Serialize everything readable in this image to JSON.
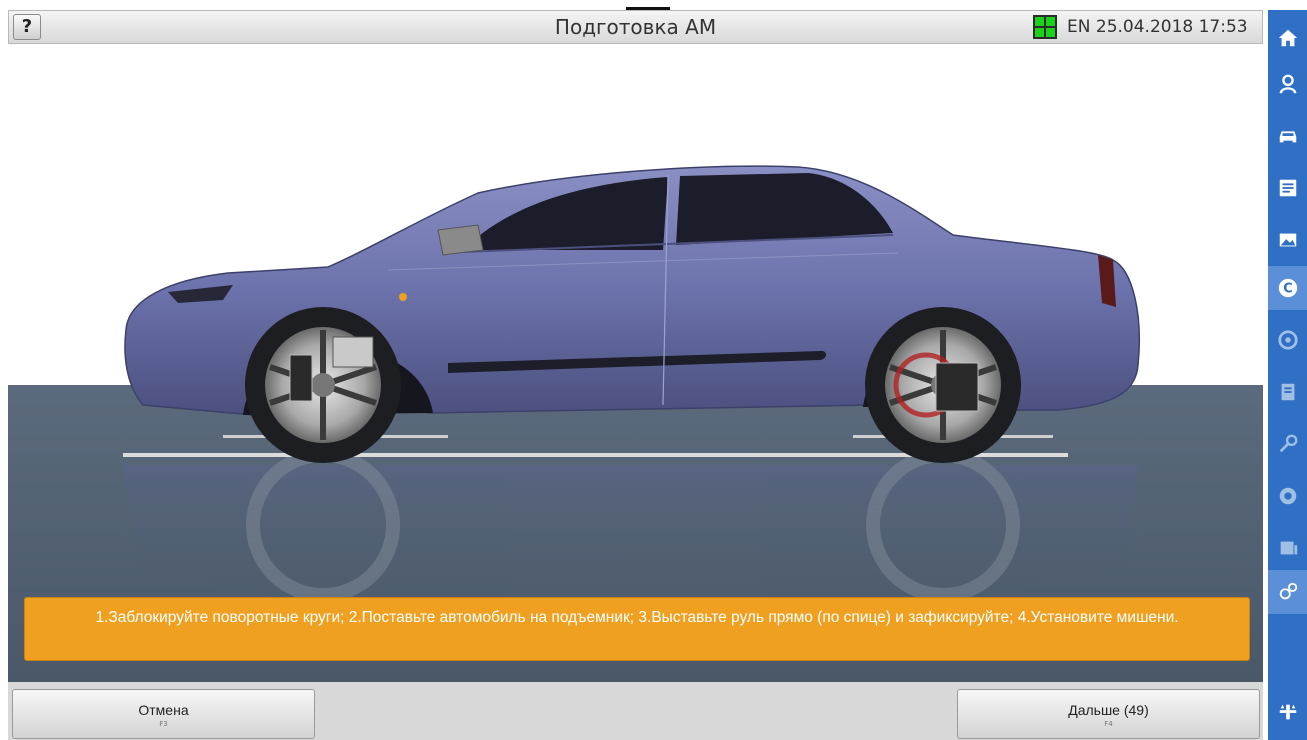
{
  "header": {
    "help_label": "?",
    "title": "Подготовка АМ",
    "language": "EN",
    "datetime": "25.04.2018 17:53",
    "status_color": "#19d219"
  },
  "sidebar": {
    "items": [
      {
        "name": "home-icon"
      },
      {
        "name": "user-icon"
      },
      {
        "name": "car-icon"
      },
      {
        "name": "list-icon"
      },
      {
        "name": "image-icon"
      },
      {
        "name": "settings-c-icon",
        "active": true
      },
      {
        "name": "gauge-icon"
      },
      {
        "name": "report-icon"
      },
      {
        "name": "wrench-icon"
      },
      {
        "name": "tire-icon"
      },
      {
        "name": "print-icon"
      },
      {
        "name": "gears-icon"
      },
      {
        "name": "lift-icon"
      }
    ],
    "background": "#2f6fc4"
  },
  "instruction": {
    "text": "1.Заблокируйте поворотные круги; 2.Поставьте автомобиль на подъемник; 3.Выставьте руль прямо (по спице) и зафиксируйте; 4.Установите мишени.",
    "color": "#f0a020"
  },
  "buttons": {
    "cancel": {
      "label": "Отмена",
      "key": "F3"
    },
    "next": {
      "label": "Дальше (49)",
      "key": "F4"
    }
  }
}
